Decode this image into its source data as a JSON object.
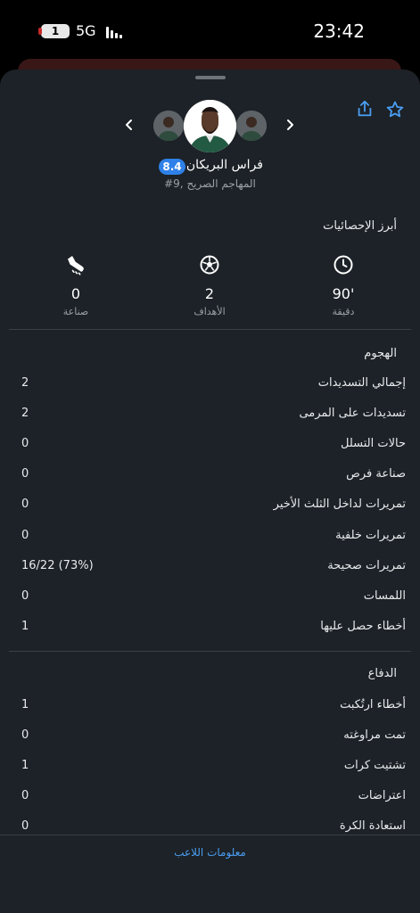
{
  "status_bar": {
    "sim": "1",
    "network": "5G",
    "time": "23:42"
  },
  "header": {
    "share_icon": "share-icon",
    "favorite_icon": "star-outline-icon",
    "prev_icon": "chevron-left-icon",
    "next_icon": "chevron-right-icon"
  },
  "player": {
    "name": "فراس البريكان",
    "rating": "8.4",
    "position": "#9, المهاجم الصريح",
    "rating_color": "#2f80e8"
  },
  "highlights": {
    "title": "أبرز الإحصائيات",
    "items": [
      {
        "icon": "clock-icon",
        "value": "90'",
        "label": "دقيقة"
      },
      {
        "icon": "football-icon",
        "value": "2",
        "label": "الأهداف"
      },
      {
        "icon": "boot-icon",
        "value": "0",
        "label": "صناعة"
      }
    ]
  },
  "attack": {
    "title": "الهجوم",
    "rows": [
      {
        "label": "إجمالي التسديدات",
        "value": "2"
      },
      {
        "label": "تسديدات على المرمى",
        "value": "2"
      },
      {
        "label": "حالات التسلل",
        "value": "0"
      },
      {
        "label": "صناعة فرص",
        "value": "0"
      },
      {
        "label": "تمريرات لداخل الثلث الأخير",
        "value": "0"
      },
      {
        "label": "تمريرات خلفية",
        "value": "0"
      },
      {
        "label": "تمريرات صحيحة",
        "value": "16/22 (73%)"
      },
      {
        "label": "اللمسات",
        "value": "0"
      },
      {
        "label": "أخطاء حصل عليها",
        "value": "1"
      }
    ]
  },
  "defense": {
    "title": "الدفاع",
    "rows": [
      {
        "label": "أخطاء ارتُكبت",
        "value": "1"
      },
      {
        "label": "تمت مراوغته",
        "value": "0"
      },
      {
        "label": "تشتيت كرات",
        "value": "1"
      },
      {
        "label": "اعتراضات",
        "value": "0"
      },
      {
        "label": "استعادة الكرة",
        "value": "0"
      }
    ]
  },
  "footer": {
    "link": "معلومات اللاعب",
    "link_color": "#4a9cf0"
  }
}
